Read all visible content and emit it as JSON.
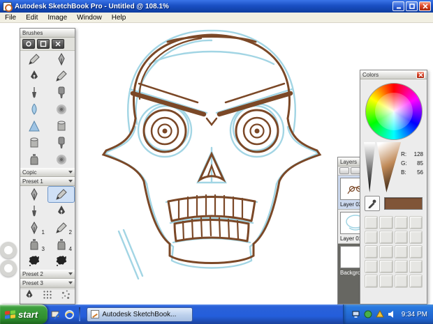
{
  "window": {
    "title": "Autodesk SketchBook Pro - Untitled @ 108.1%"
  },
  "menubar": {
    "items": [
      "File",
      "Edit",
      "Image",
      "Window",
      "Help"
    ]
  },
  "brushes": {
    "title": "Brushes",
    "sections": [
      "Copic",
      "Preset 1",
      "Preset 2",
      "Preset 3"
    ],
    "numbers": [
      "1",
      "2",
      "3",
      "4"
    ]
  },
  "colors": {
    "title": "Colors",
    "r_label": "R:",
    "r_value": "128",
    "g_label": "G:",
    "g_value": "85",
    "b_label": "B:",
    "b_value": "56"
  },
  "layers": {
    "title": "Layers",
    "items": [
      "Layer 02",
      "Layer 01",
      "Backgro"
    ]
  },
  "taskbar": {
    "start_label": "start",
    "task_label": "Autodesk SketchBook...",
    "time": "9:34 PM"
  },
  "theme": {
    "current-color": "#805538",
    "sketch-blue": "#9ed3e3",
    "ink-brown": "#7b4827",
    "taskbar-blue": "#245edb",
    "start-green": "#2f8f2f"
  }
}
